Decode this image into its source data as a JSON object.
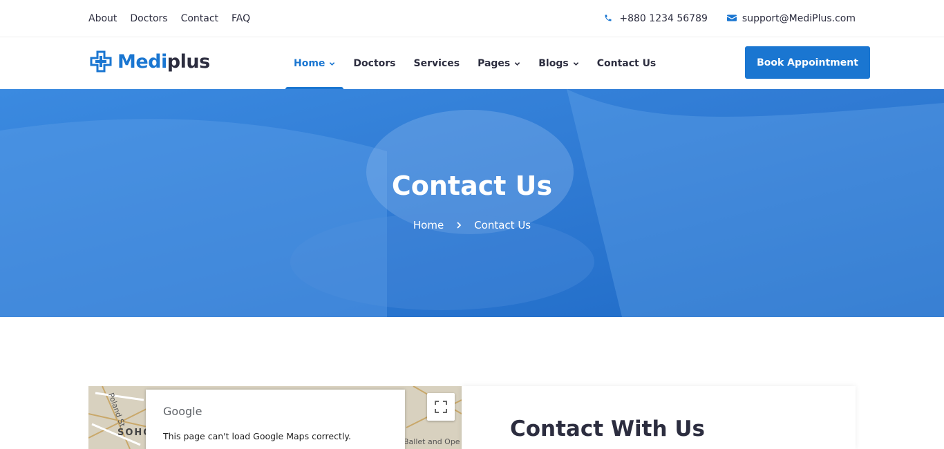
{
  "topbar": {
    "links": [
      "About",
      "Doctors",
      "Contact",
      "FAQ"
    ],
    "phone": "+880 1234 56789",
    "email": "support@MediPlus.com"
  },
  "header": {
    "logo_part1": "Medi",
    "logo_part2": "plus",
    "nav": [
      {
        "label": "Home",
        "has_dropdown": true,
        "active": true
      },
      {
        "label": "Doctors",
        "has_dropdown": false
      },
      {
        "label": "Services",
        "has_dropdown": false
      },
      {
        "label": "Pages",
        "has_dropdown": true
      },
      {
        "label": "Blogs",
        "has_dropdown": true
      },
      {
        "label": "Contact Us",
        "has_dropdown": false
      }
    ],
    "cta": "Book Appointment"
  },
  "hero": {
    "title": "Contact Us",
    "breadcrumb": [
      "Home",
      "Contact Us"
    ]
  },
  "map": {
    "provider": "Google",
    "error": "This page can't load Google Maps correctly.",
    "labels": [
      "Poland St",
      "SOHO",
      "Ballet and Ope"
    ]
  },
  "contact": {
    "heading": "Contact With Us"
  },
  "colors": {
    "accent": "#1a76d1",
    "text": "#2c2d3f"
  }
}
